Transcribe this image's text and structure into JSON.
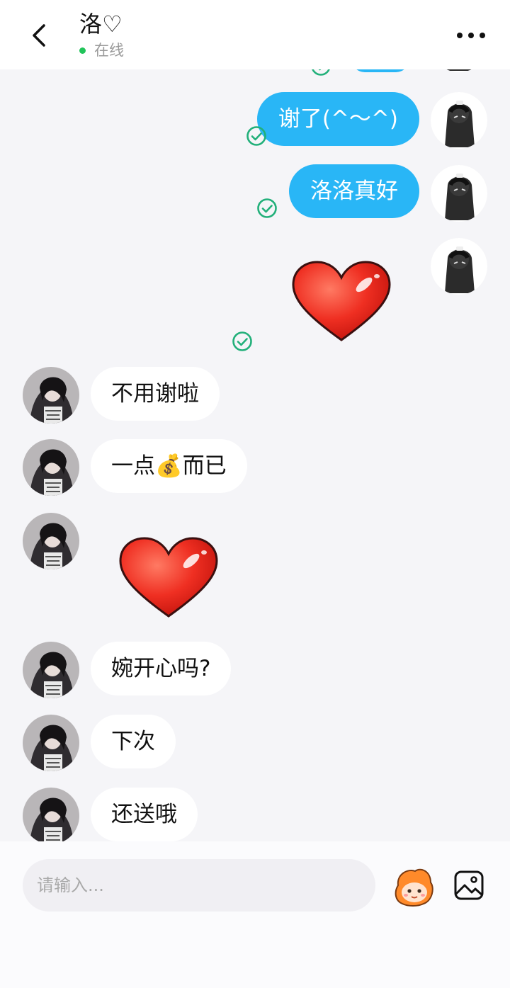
{
  "header": {
    "back_icon": "back-chevron-icon",
    "title": "洛♡",
    "status": "在线",
    "status_color": "#21c45a",
    "more_icon": "more-dots-icon"
  },
  "messages": [
    {
      "direction": "out",
      "type": "text",
      "text": "谢了(^〜^)",
      "read": true
    },
    {
      "direction": "out",
      "type": "text",
      "text": "洛洛真好",
      "read": true
    },
    {
      "direction": "out",
      "type": "sticker",
      "sticker": "heart",
      "read": true
    },
    {
      "direction": "in",
      "type": "text",
      "text": "不用谢啦"
    },
    {
      "direction": "in",
      "type": "text",
      "text": "一点💰而已"
    },
    {
      "direction": "in",
      "type": "sticker",
      "sticker": "heart"
    },
    {
      "direction": "in",
      "type": "text",
      "text": "婉开心吗?"
    },
    {
      "direction": "in",
      "type": "text",
      "text": "下次"
    },
    {
      "direction": "in",
      "type": "text",
      "text": "还送哦"
    }
  ],
  "input": {
    "placeholder": "请输入..."
  },
  "toolbar": {
    "emoji_icon": "emoji-face-icon",
    "image_icon": "image-icon"
  },
  "colors": {
    "outgoing_bubble": "#29b6f6",
    "incoming_bubble": "#ffffff",
    "read_check": "#22b07a"
  }
}
